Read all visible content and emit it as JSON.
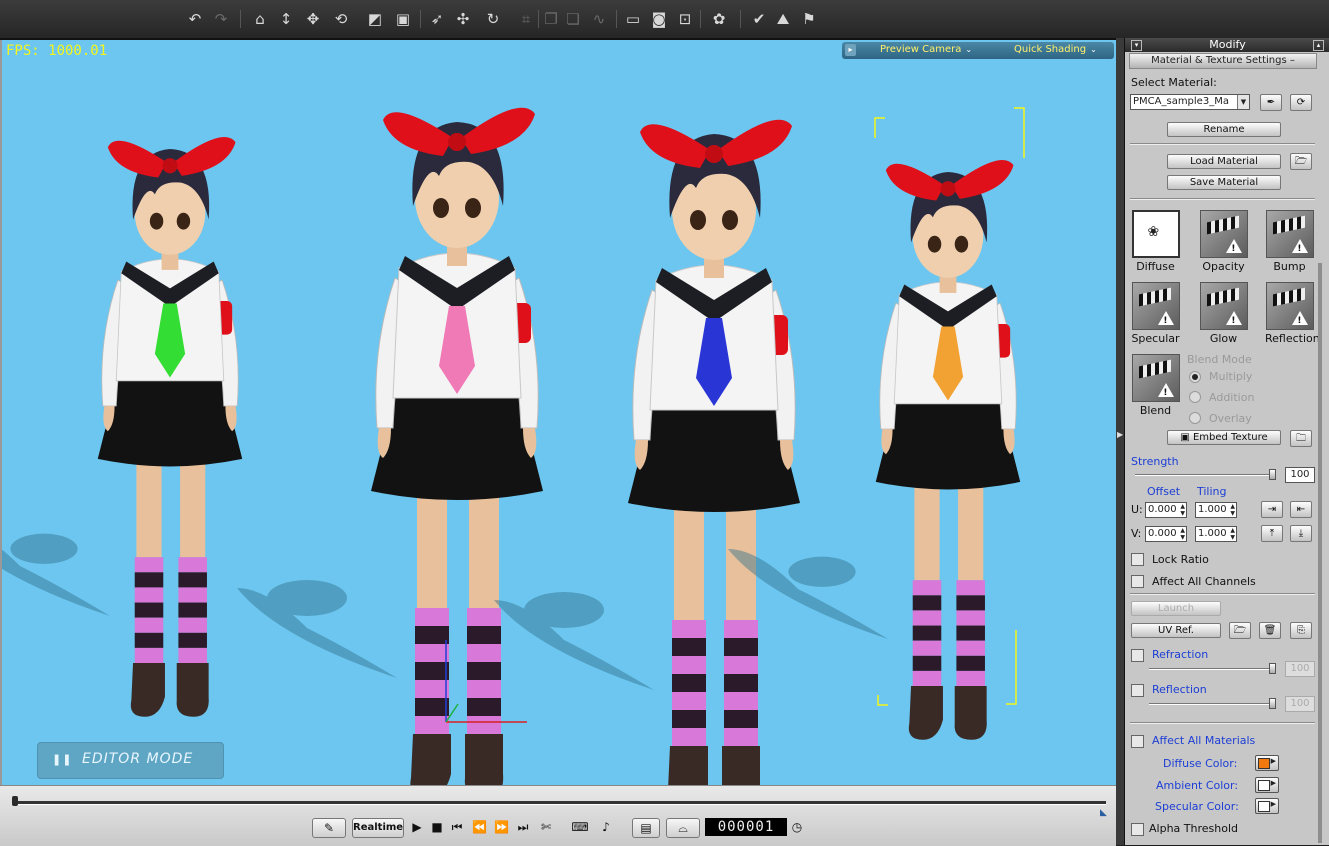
{
  "toolbar": {
    "icons": [
      "undo-icon",
      "redo-icon",
      "home-icon",
      "move-down-icon",
      "move-icon",
      "rotate-icon",
      "scale-icon",
      "fit-icon",
      "select-icon",
      "transform-icon",
      "rotate-object-icon",
      "snap-icon",
      "duplicate-icon",
      "curve-icon",
      "layout-icon",
      "camera-icon",
      "screenshot-icon",
      "fx-icon",
      "check-icon",
      "terrain-icon",
      "flag-icon"
    ]
  },
  "viewport": {
    "fps": "FPS: 1000.01",
    "camera": "Preview Camera",
    "shading": "Quick Shading",
    "editor_mode": "EDITOR MODE",
    "background_color": "#6cc6ef",
    "tie_colors": [
      "#33dd33",
      "#f07ab5",
      "#2a35d6",
      "#f2a233"
    ],
    "bow_color": "#e0101a",
    "sock_stripe_color": "#d878d8"
  },
  "timeline": {
    "realtime_label": "Realtime",
    "time": "000001"
  },
  "panel": {
    "title": "Modify",
    "section": "Material & Texture Settings",
    "select_material_label": "Select Material:",
    "material_value": "PMCA_sample3_Ma",
    "rename": "Rename",
    "load_material": "Load Material",
    "save_material": "Save Material",
    "channels": [
      "Diffuse",
      "Opacity",
      "Bump",
      "Specular",
      "Glow",
      "Reflection",
      "Blend"
    ],
    "blend_mode_label": "Blend Mode",
    "blend_modes": [
      "Multiply",
      "Addition",
      "Overlay"
    ],
    "embed_texture": "Embed Texture",
    "strength_label": "Strength",
    "strength_value": "100",
    "offset_label": "Offset",
    "tiling_label": "Tiling",
    "u_label": "U:",
    "v_label": "V:",
    "u_offset": "0.000",
    "u_tiling": "1.000",
    "v_offset": "0.000",
    "v_tiling": "1.000",
    "lock_ratio": "Lock Ratio",
    "affect_all_channels": "Affect All Channels",
    "launch": "Launch",
    "uv_ref": "UV Ref.",
    "refraction": "Refraction",
    "refraction_value": "100",
    "reflection": "Reflection",
    "reflection_value": "100",
    "affect_all_materials": "Affect All Materials",
    "diffuse_color_label": "Diffuse Color:",
    "ambient_color_label": "Ambient Color:",
    "specular_color_label": "Specular Color:",
    "diffuse_color": "#f07a10",
    "ambient_color": "#ffffff",
    "specular_color": "#ffffff",
    "alpha_threshold": "Alpha Threshold"
  }
}
